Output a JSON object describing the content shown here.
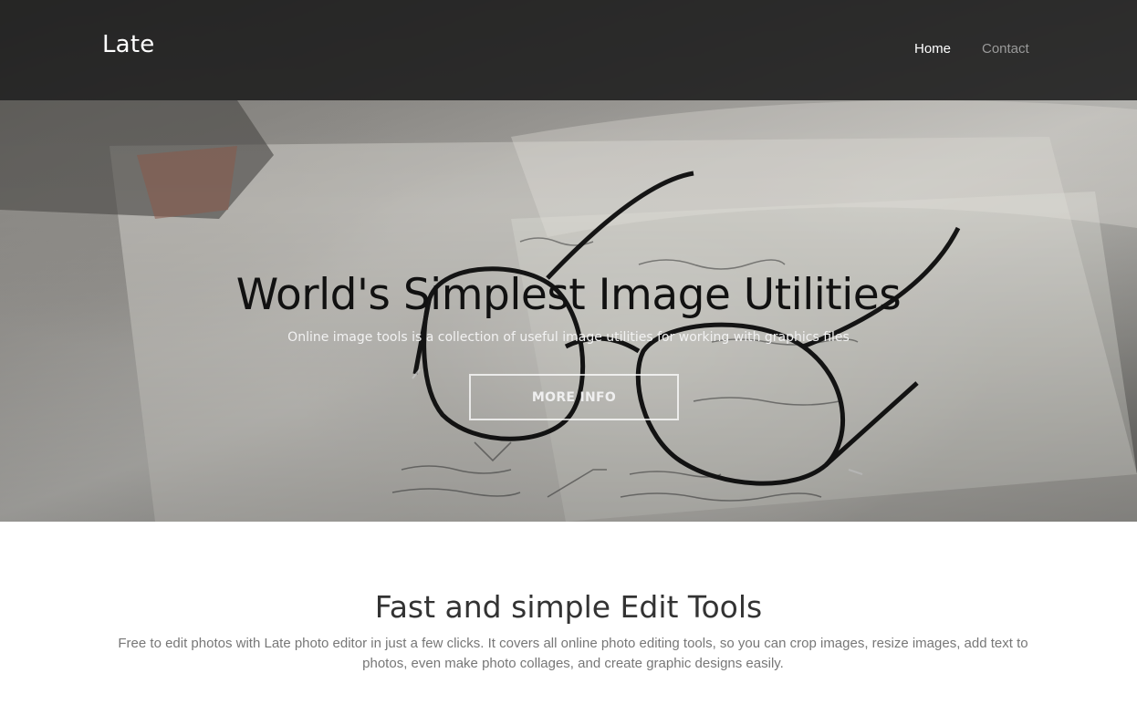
{
  "navbar": {
    "brand": "Late",
    "links": [
      {
        "label": "Home",
        "active": true
      },
      {
        "label": "Contact",
        "active": false
      }
    ]
  },
  "hero": {
    "title": "World's Simplest Image Utilities",
    "subtitle": "Online image tools is a collection of useful image utilities for working with graphics files",
    "button_label": "MORE INFO"
  },
  "features": {
    "title": "Fast and simple Edit Tools",
    "description": "Free to edit photos with Late photo editor in just a few clicks. It covers all online photo editing tools, so you can crop images, resize images, add text to photos, even make photo collages, and create graphic designs easily."
  },
  "colors": {
    "navbar_bg": "#1c1c1c",
    "nav_active": "#ffffff",
    "nav_inactive": "#9a9a9a",
    "hero_title": "#111111",
    "body_text": "#777777",
    "heading_text": "#333333"
  }
}
